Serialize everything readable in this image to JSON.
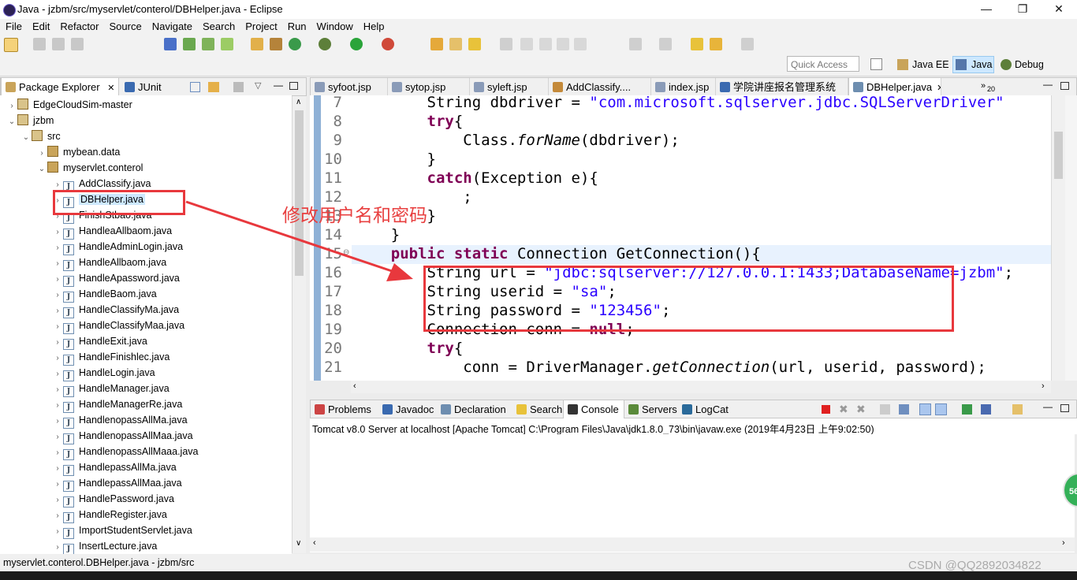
{
  "window": {
    "title": "Java - jzbm/src/myservlet/conterol/DBHelper.java - Eclipse",
    "minimize": "—",
    "maximize": "❐",
    "close": "✕"
  },
  "menu": [
    "File",
    "Edit",
    "Refactor",
    "Source",
    "Navigate",
    "Search",
    "Project",
    "Run",
    "Window",
    "Help"
  ],
  "perspectives": {
    "quick_access": "Quick Access",
    "items": [
      "Java EE",
      "Java",
      "Debug"
    ],
    "active": "Java"
  },
  "left_panel": {
    "tabs": [
      "Package Explorer",
      "JUnit"
    ],
    "tree": [
      {
        "label": "EdgeCloudSim-master",
        "depth": 0,
        "arrow": "›",
        "icon": "project"
      },
      {
        "label": "jzbm",
        "depth": 0,
        "arrow": "⌄",
        "icon": "project"
      },
      {
        "label": "src",
        "depth": 1,
        "arrow": "⌄",
        "icon": "source-folder"
      },
      {
        "label": "mybean.data",
        "depth": 2,
        "arrow": "›",
        "icon": "package"
      },
      {
        "label": "myservlet.conterol",
        "depth": 2,
        "arrow": "⌄",
        "icon": "package"
      },
      {
        "label": "AddClassify.java",
        "depth": 3,
        "arrow": "›",
        "icon": "java"
      },
      {
        "label": "DBHelper.java",
        "depth": 3,
        "arrow": "›",
        "icon": "java",
        "selected": true
      },
      {
        "label": "FinishStbao.java",
        "depth": 3,
        "arrow": "›",
        "icon": "java"
      },
      {
        "label": "HandleaAllbaom.java",
        "depth": 3,
        "arrow": "›",
        "icon": "java"
      },
      {
        "label": "HandleAdminLogin.java",
        "depth": 3,
        "arrow": "›",
        "icon": "java"
      },
      {
        "label": "HandleAllbaom.java",
        "depth": 3,
        "arrow": "›",
        "icon": "java"
      },
      {
        "label": "HandleApassword.java",
        "depth": 3,
        "arrow": "›",
        "icon": "java"
      },
      {
        "label": "HandleBaom.java",
        "depth": 3,
        "arrow": "›",
        "icon": "java"
      },
      {
        "label": "HandleClassifyMa.java",
        "depth": 3,
        "arrow": "›",
        "icon": "java"
      },
      {
        "label": "HandleClassifyMaa.java",
        "depth": 3,
        "arrow": "›",
        "icon": "java"
      },
      {
        "label": "HandleExit.java",
        "depth": 3,
        "arrow": "›",
        "icon": "java"
      },
      {
        "label": "HandleFinishlec.java",
        "depth": 3,
        "arrow": "›",
        "icon": "java"
      },
      {
        "label": "HandleLogin.java",
        "depth": 3,
        "arrow": "›",
        "icon": "java"
      },
      {
        "label": "HandleManager.java",
        "depth": 3,
        "arrow": "›",
        "icon": "java"
      },
      {
        "label": "HandleManagerRe.java",
        "depth": 3,
        "arrow": "›",
        "icon": "java"
      },
      {
        "label": "HandlenopassAllMa.java",
        "depth": 3,
        "arrow": "›",
        "icon": "java"
      },
      {
        "label": "HandlenopassAllMaa.java",
        "depth": 3,
        "arrow": "›",
        "icon": "java"
      },
      {
        "label": "HandlenopassAllMaaa.java",
        "depth": 3,
        "arrow": "›",
        "icon": "java"
      },
      {
        "label": "HandlepassAllMa.java",
        "depth": 3,
        "arrow": "›",
        "icon": "java"
      },
      {
        "label": "HandlepassAllMaa.java",
        "depth": 3,
        "arrow": "›",
        "icon": "java"
      },
      {
        "label": "HandlePassword.java",
        "depth": 3,
        "arrow": "›",
        "icon": "java"
      },
      {
        "label": "HandleRegister.java",
        "depth": 3,
        "arrow": "›",
        "icon": "java"
      },
      {
        "label": "ImportStudentServlet.java",
        "depth": 3,
        "arrow": "›",
        "icon": "java"
      },
      {
        "label": "InsertLecture.java",
        "depth": 3,
        "arrow": "›",
        "icon": "java"
      }
    ]
  },
  "editor": {
    "tabs": [
      "syfoot.jsp",
      "sytop.jsp",
      "syleft.jsp",
      "AddClassify....",
      "index.jsp",
      "学院讲座报名管理系统",
      "DBHelper.java"
    ],
    "active_tab": "DBHelper.java",
    "overflow_count": "20",
    "lines": [
      {
        "num": "7",
        "tokens": [
          {
            "t": "        String dbdriver = "
          },
          {
            "t": "\"com.microsoft.sqlserver.jdbc.SQLServerDriver\"",
            "c": "str"
          }
        ]
      },
      {
        "num": "8",
        "tokens": [
          {
            "t": "        "
          },
          {
            "t": "try",
            "c": "kw"
          },
          {
            "t": "{"
          }
        ]
      },
      {
        "num": "9",
        "tokens": [
          {
            "t": "            Class."
          },
          {
            "t": "forName",
            "c": "it"
          },
          {
            "t": "(dbdriver);"
          }
        ]
      },
      {
        "num": "10",
        "tokens": [
          {
            "t": "        }"
          }
        ]
      },
      {
        "num": "11",
        "tokens": [
          {
            "t": "        "
          },
          {
            "t": "catch",
            "c": "kw"
          },
          {
            "t": "(Exception e){"
          }
        ]
      },
      {
        "num": "12",
        "tokens": [
          {
            "t": "            ;"
          }
        ]
      },
      {
        "num": "13",
        "tokens": [
          {
            "t": "        }"
          }
        ]
      },
      {
        "num": "14",
        "tokens": [
          {
            "t": "    }"
          }
        ]
      },
      {
        "num": "15",
        "tokens": [
          {
            "t": "    "
          },
          {
            "t": "public",
            "c": "kw"
          },
          {
            "t": " "
          },
          {
            "t": "static",
            "c": "kw"
          },
          {
            "t": " Connection GetConnection(){"
          }
        ]
      },
      {
        "num": "16",
        "tokens": [
          {
            "t": "        String url = "
          },
          {
            "t": "\"jdbc:sqlserver://127.0.0.1:1433;DatabaseName=jzbm\"",
            "c": "str"
          },
          {
            "t": ";"
          }
        ]
      },
      {
        "num": "17",
        "tokens": [
          {
            "t": "        String userid = "
          },
          {
            "t": "\"sa\"",
            "c": "str"
          },
          {
            "t": ";"
          }
        ]
      },
      {
        "num": "18",
        "tokens": [
          {
            "t": "        String password = "
          },
          {
            "t": "\"123456\"",
            "c": "str"
          },
          {
            "t": ";"
          }
        ]
      },
      {
        "num": "19",
        "tokens": [
          {
            "t": "        Connection conn = "
          },
          {
            "t": "null",
            "c": "kw"
          },
          {
            "t": ";"
          }
        ]
      },
      {
        "num": "20",
        "tokens": [
          {
            "t": "        "
          },
          {
            "t": "try",
            "c": "kw"
          },
          {
            "t": "{"
          }
        ]
      },
      {
        "num": "21",
        "tokens": [
          {
            "t": "            conn = DriverManager."
          },
          {
            "t": "getConnection",
            "c": "it"
          },
          {
            "t": "(url, userid, password);"
          }
        ]
      }
    ]
  },
  "bottom_panel": {
    "tabs": [
      "Problems",
      "Javadoc",
      "Declaration",
      "Search",
      "Console",
      "Servers",
      "LogCat"
    ],
    "active_tab": "Console",
    "console_header": "Tomcat v8.0 Server at localhost [Apache Tomcat] C:\\Program Files\\Java\\jdk1.8.0_73\\bin\\javaw.exe (2019年4月23日 上午9:02:50)"
  },
  "status_bar": {
    "text": "myservlet.conterol.DBHelper.java - jzbm/src"
  },
  "annotation": {
    "text": "修改用户名和密码",
    "color": "#e8383d"
  },
  "overlay": {
    "watermark": "CSDN @QQ2892034822",
    "badge": "56"
  },
  "colors": {
    "keyword": "#7f0055",
    "string": "#2a00ff",
    "selection": "#cde8ff",
    "current_line": "#e8f2fe"
  }
}
